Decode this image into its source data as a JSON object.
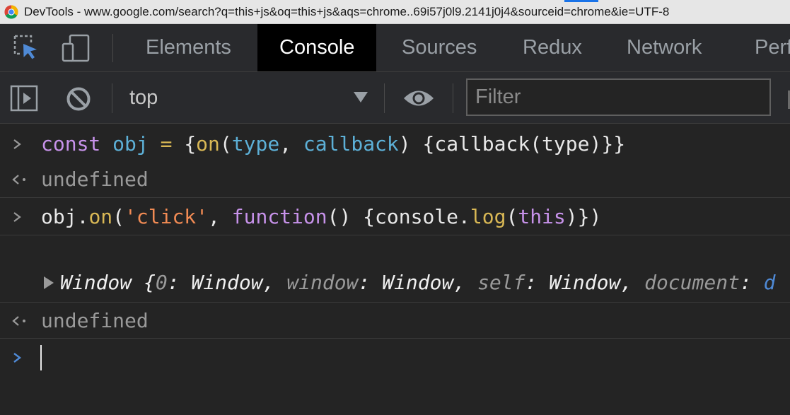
{
  "window": {
    "title": "DevTools - www.google.com/search?q=this+js&oq=this+js&aqs=chrome..69i57j0l9.2141j0j4&sourceid=chrome&ie=UTF-8"
  },
  "tabs": [
    {
      "label": "Elements",
      "active": false
    },
    {
      "label": "Console",
      "active": true
    },
    {
      "label": "Sources",
      "active": false
    },
    {
      "label": "Redux",
      "active": false
    },
    {
      "label": "Network",
      "active": false
    },
    {
      "label": "Perf",
      "active": false
    }
  ],
  "toolbar": {
    "context": "top",
    "filter_placeholder": "Filter"
  },
  "console": {
    "line1": {
      "kw": "const",
      "name": "obj",
      "eq": " = ",
      "brace_open": "{",
      "method": "on",
      "paren_open": "(",
      "param1": "type",
      "comma": ", ",
      "param2": "callback",
      "rest": ") {callback(type)}}"
    },
    "result1": "undefined",
    "line2": {
      "obj": "obj.",
      "method": "on",
      "paren_open": "(",
      "str": "'click'",
      "comma": ", ",
      "kw": "function",
      "mid": "() {console.",
      "log": "log",
      "paren2": "(",
      "this": "this",
      "close": ")})"
    },
    "log_output": {
      "prefix": "Window {",
      "k0": "0",
      "v0": "Window",
      "k1": "window",
      "v1": "Window",
      "k2": "self",
      "v2": "Window",
      "k3": "document",
      "colon": ": ",
      "sep": ", ",
      "cut": "d"
    },
    "result2": "undefined"
  },
  "colors": {
    "background": "#242424",
    "keyword": "#c792ea",
    "function": "#d9b855",
    "identifier": "#5db0d7",
    "string": "#f28b54",
    "active_tab": "#000000",
    "prompt_active": "#4f8ad6"
  },
  "icons": [
    "chrome-logo-icon",
    "inspect-element-icon",
    "device-toolbar-icon",
    "sidebar-toggle-icon",
    "clear-console-icon",
    "dropdown-arrow-icon",
    "live-expression-eye-icon",
    "prompt-chevron-icon",
    "result-arrow-icon",
    "expand-triangle-icon"
  ]
}
